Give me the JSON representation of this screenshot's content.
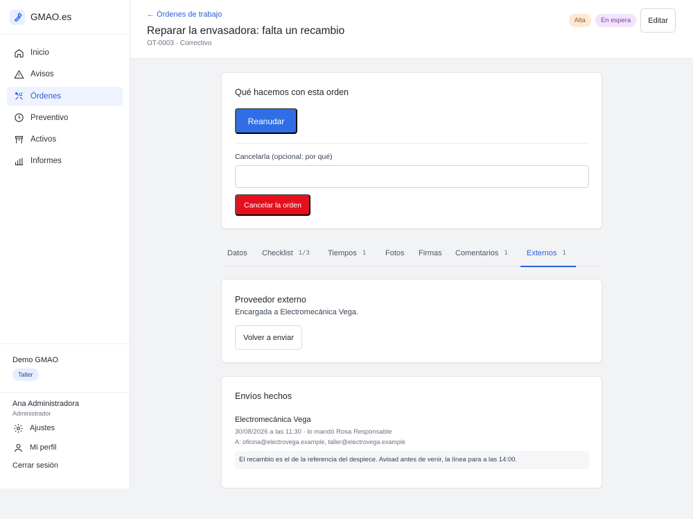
{
  "brand": {
    "name": "GMAO.es",
    "icon": "wrench-icon",
    "accent": "#2f6ee5"
  },
  "nav": {
    "items": [
      {
        "label": "Inicio",
        "icon": "home-icon"
      },
      {
        "label": "Avisos",
        "icon": "warning-icon"
      },
      {
        "label": "Órdenes",
        "icon": "tools-icon",
        "active": true
      },
      {
        "label": "Preventivo",
        "icon": "clock-icon"
      },
      {
        "label": "Activos",
        "icon": "asset-icon"
      },
      {
        "label": "Informes",
        "icon": "bar-chart-icon"
      }
    ]
  },
  "org": {
    "name": "Demo GMAO",
    "badge": "Taller"
  },
  "user": {
    "name": "Ana Administradora",
    "role": "Administrador",
    "settings": "Ajustes",
    "profile": "Mi perfil",
    "logout": "Cerrar sesión"
  },
  "header": {
    "back": "← Órdenes de trabajo",
    "title": "Reparar la envasadora: falta un recambio",
    "subtitle": "OT-0003 · Correctivo",
    "badge_priority": "Alta",
    "badge_status": "En espera",
    "edit": "Editar"
  },
  "actions": {
    "title": "Qué hacemos con esta orden",
    "resume": "Reanudar",
    "cancel_label": "Cancelarla (opcional: por qué)",
    "cancel_value": "",
    "cancel_button": "Cancelar la orden"
  },
  "tabs": [
    {
      "label": "Datos",
      "count": ""
    },
    {
      "label": "Checklist",
      "count": "1/3"
    },
    {
      "label": "Tiempos",
      "count": "1"
    },
    {
      "label": "Fotos",
      "count": ""
    },
    {
      "label": "Firmas",
      "count": ""
    },
    {
      "label": "Comentarios",
      "count": "1"
    },
    {
      "label": "Externos",
      "count": "1",
      "active": true
    }
  ],
  "external": {
    "title": "Proveedor externo",
    "text": "Encargada a Electromecánica Vega.",
    "resend": "Volver a enviar"
  },
  "shipments": {
    "title": "Envíos hechos",
    "items": [
      {
        "name": "Electromecánica Vega",
        "meta": "30/08/2026 a las 11:30 · lo mandó Rosa Responsable",
        "to": "A: oficina@electrovega.example, taller@electrovega.example",
        "message": "El recambio es el de la referencia del despiece. Avisad antes de venir, la línea para a las 14:00."
      }
    ]
  },
  "colors": {
    "primary": "#2f6ee5",
    "danger": "#e5101e",
    "priority": "#fde8d6",
    "status": "#f1e4fb"
  }
}
